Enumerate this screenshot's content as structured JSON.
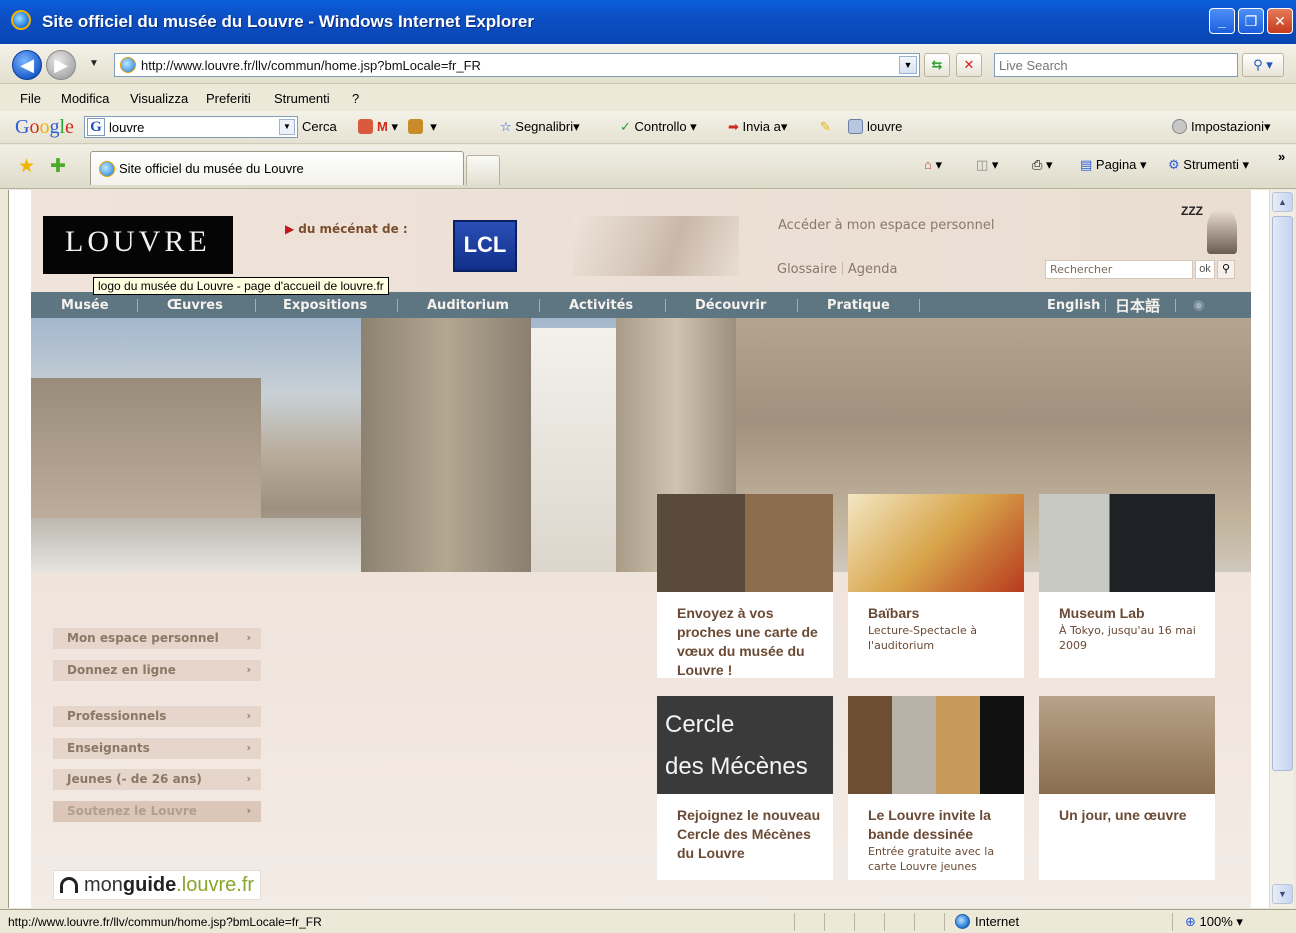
{
  "window": {
    "title": "Site officiel du musée du Louvre - Windows Internet Explorer",
    "controls": {
      "minimize": "_",
      "maximize": "❐",
      "close": "✕"
    }
  },
  "addressbar": {
    "url": "http://www.louvre.fr/llv/commun/home.jsp?bmLocale=fr_FR",
    "search_placeholder": "Live Search"
  },
  "menubar": {
    "items": [
      "File",
      "Modifica",
      "Visualizza",
      "Preferiti",
      "Strumenti",
      "?"
    ]
  },
  "google_toolbar": {
    "logo": "Google",
    "query": "louvre",
    "cerca": "Cerca",
    "segnalibri": "Segnalibri",
    "controllo": "Controllo",
    "invia": "Invia a",
    "highlight": "louvre",
    "impostazioni": "Impostazioni"
  },
  "tabbar": {
    "tab_title": "Site officiel du musée du Louvre",
    "pagina": "Pagina",
    "strumenti": "Strumenti",
    "more": "»"
  },
  "page": {
    "logo": "LOUVRE",
    "logo_tooltip": "logo du musée du Louvre - page d'accueil de louvre.fr",
    "mecenat": "du mécénat de :",
    "sponsor": "LCL",
    "acceder": "Accéder à mon espace personnel",
    "glossaire": "Glossaire",
    "agenda": "Agenda",
    "search_placeholder": "Rechercher",
    "ok": "ok",
    "zzz": "ZZZ",
    "nav": [
      {
        "label": "Musée"
      },
      {
        "label": "Œuvres"
      },
      {
        "label": "Expositions"
      },
      {
        "label": "Auditorium"
      },
      {
        "label": "Activités"
      },
      {
        "label": "Découvrir"
      },
      {
        "label": "Pratique"
      }
    ],
    "lang_en": "English",
    "lang_ja": "日本語",
    "sidebar": [
      {
        "label": "Mon espace personnel"
      },
      {
        "label": "Donnez en ligne"
      },
      {
        "label": "Professionnels"
      },
      {
        "label": "Enseignants"
      },
      {
        "label": "Jeunes (- de 26 ans)"
      },
      {
        "label": "Soutenez le Louvre"
      }
    ],
    "monguide": {
      "a": "mon",
      "b": "guide",
      "c": ".louvre.fr"
    },
    "cards": [
      {
        "title": "Envoyez à vos proches une carte de vœux du musée du Louvre !",
        "sub": ""
      },
      {
        "title": "Baïbars",
        "sub": "Lecture-Spectacle à l'auditorium"
      },
      {
        "title": "Museum Lab",
        "sub": "À Tokyo, jusqu'au 16 mai 2009"
      },
      {
        "title": "Rejoignez le nouveau Cercle des Mécènes du Louvre",
        "sub": "",
        "img_text_1": "Cercle",
        "img_text_2": "des Mécènes"
      },
      {
        "title": "Le Louvre invite la bande dessinée",
        "sub": "Entrée gratuite avec la carte Louvre jeunes"
      },
      {
        "title": "Un jour, une œuvre",
        "sub": ""
      }
    ]
  },
  "statusbar": {
    "url": "http://www.louvre.fr/llv/commun/home.jsp?bmLocale=fr_FR",
    "zone": "Internet",
    "zoom": "100%"
  }
}
